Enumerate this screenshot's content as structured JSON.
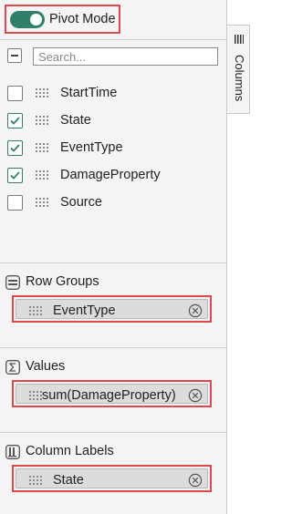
{
  "pivot_mode": {
    "label": "Pivot Mode",
    "enabled": true
  },
  "side_tab": {
    "label": "Columns",
    "icon": "columns-icon"
  },
  "search": {
    "placeholder": "Search..."
  },
  "columns": [
    {
      "name": "StartTime",
      "checked": false
    },
    {
      "name": "State",
      "checked": true
    },
    {
      "name": "EventType",
      "checked": true
    },
    {
      "name": "DamageProperty",
      "checked": true
    },
    {
      "name": "Source",
      "checked": false
    }
  ],
  "sections": {
    "row_groups": {
      "title": "Row Groups",
      "icon": "row-groups-icon",
      "chip": "EventType"
    },
    "values": {
      "title": "Values",
      "icon": "sigma-icon",
      "chip": "sum(DamageProperty)"
    },
    "column_labels": {
      "title": "Column Labels",
      "icon": "column-labels-icon",
      "chip": "State"
    }
  },
  "colors": {
    "accent": "#2f7f6b",
    "highlight": "#e0474c",
    "panel_bg": "#f4f4f4",
    "chip_bg": "#dcdcdc"
  }
}
